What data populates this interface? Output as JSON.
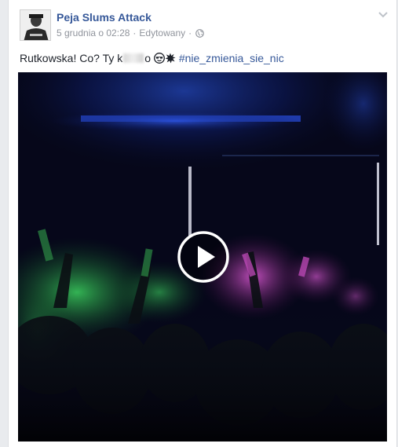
{
  "post": {
    "page_name": "Peja Slums Attack",
    "date": "5 grudnia o 02:28",
    "separator": "·",
    "edited": "Edytowany",
    "text_before": "Rutkowska! Co? Ty k",
    "text_after": "o",
    "hashtag": "#nie_zmienia_sie_nic"
  },
  "icons": {
    "avatar": "profile-photo",
    "audience": "globe-icon",
    "menu": "chevron-down-icon",
    "emoji_1": "sunglasses-emoji",
    "emoji_2": "explosion-emoji",
    "play": "play-icon"
  },
  "colors": {
    "link": "#365899",
    "meta": "#90949c",
    "text": "#1d2129"
  }
}
